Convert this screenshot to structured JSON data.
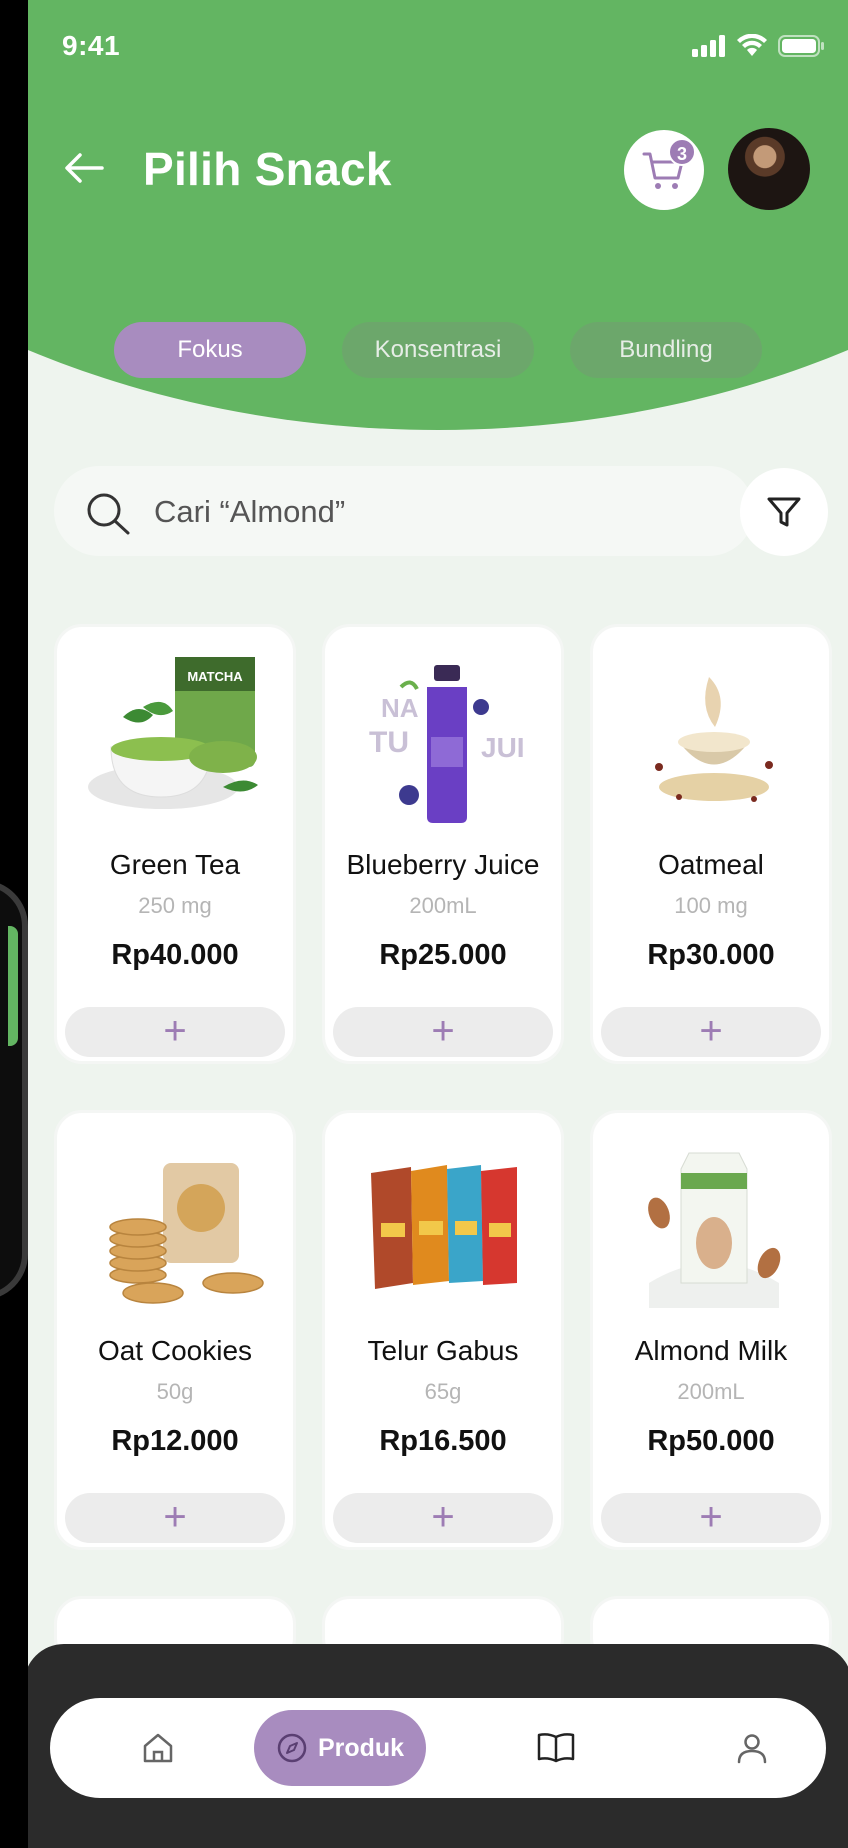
{
  "status": {
    "time": "9:41"
  },
  "header": {
    "title": "Pilih Snack",
    "cart_count": "3"
  },
  "tabs": [
    {
      "label": "Fokus",
      "active": true
    },
    {
      "label": "Konsentrasi",
      "active": false
    },
    {
      "label": "Bundling",
      "active": false
    }
  ],
  "search": {
    "placeholder": "Cari “Almond”"
  },
  "products": [
    {
      "name": "Green Tea",
      "qty": "250 mg",
      "price": "Rp40.000",
      "icon": "matcha-tea-image"
    },
    {
      "name": "Blueberry Juice",
      "qty": "200mL",
      "price": "Rp25.000",
      "icon": "juice-bottle-image"
    },
    {
      "name": "Oatmeal",
      "qty": "100 mg",
      "price": "Rp30.000",
      "icon": "oatmeal-bowl-image"
    },
    {
      "name": "Oat Cookies",
      "qty": "50g",
      "price": "Rp12.000",
      "icon": "cookies-image"
    },
    {
      "name": "Telur Gabus",
      "qty": "65g",
      "price": "Rp16.500",
      "icon": "snack-packs-image"
    },
    {
      "name": "Almond Milk",
      "qty": "200mL",
      "price": "Rp50.000",
      "icon": "almond-milk-image"
    }
  ],
  "add_label": "+",
  "nav": {
    "active_label": "Produk"
  },
  "colors": {
    "primary_green": "#63b562",
    "accent_purple": "#a88cbf",
    "background": "#eef4ee"
  }
}
